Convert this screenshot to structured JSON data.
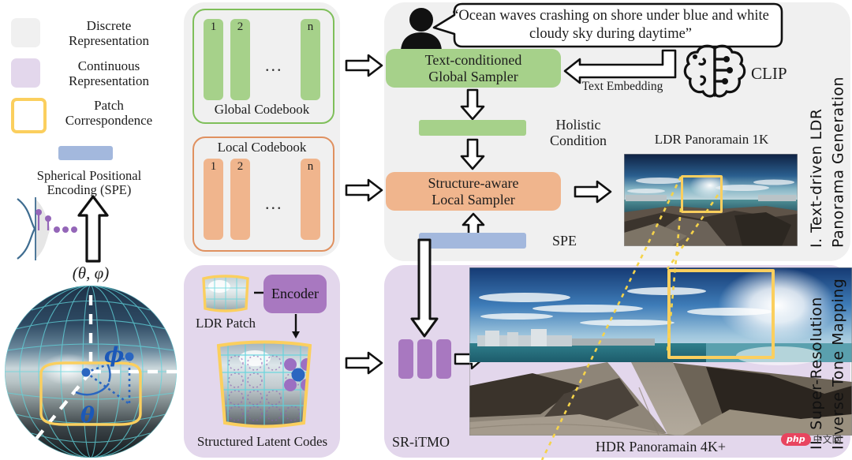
{
  "legend": {
    "items": [
      {
        "name": "discrete",
        "label": "Discrete\nRepresentation",
        "color": "#f0f0f0"
      },
      {
        "name": "continuous",
        "label": "Continuous\nRepresentation",
        "color": "#e3d7ec"
      },
      {
        "name": "patch",
        "label": "Patch\nCorrespondence",
        "color": "#fbcf5e"
      }
    ],
    "spe_label": "Spherical Positional\nEncoding (SPE)",
    "spe_color": "#a3b8dd"
  },
  "sphere": {
    "coords_label": "(θ, φ)",
    "phi": "ϕ",
    "theta": "θ"
  },
  "codebooks": {
    "global": {
      "title": "Global Codebook",
      "bar_labels": [
        "1",
        "2",
        "n"
      ],
      "ellipsis": "...",
      "color": "#a6d18a",
      "border": "#7fbf5a"
    },
    "local": {
      "title": "Local Codebook",
      "bar_labels": [
        "1",
        "2",
        "n"
      ],
      "ellipsis": "...",
      "color": "#f0b58d",
      "border": "#e09160"
    }
  },
  "stage1": {
    "prompt": "“Ocean waves crashing on shore under blue and white cloudy sky during daytime”",
    "global_sampler": "Text-conditioned\nGlobal Sampler",
    "text_embedding": "Text Embedding",
    "clip": "CLIP",
    "holistic_condition": "Holistic\nCondition",
    "local_sampler": "Structure-aware\nLocal Sampler",
    "spe": "SPE",
    "pano_label": "LDR Panoramain 1K",
    "section_title": "I. Text-driven LDR\nPanorama Generation"
  },
  "stage2": {
    "ldr_patch": "LDR Patch",
    "encoder": "Encoder",
    "latent_codes": "Structured Latent Codes",
    "sritmo": "SR-iTMO",
    "pano_label": "HDR Panoramain 4K+",
    "section_title": "II. Super-Resolution\nInverse Tone Mapping"
  },
  "watermark": {
    "brand": "php",
    "cn": "中文网"
  }
}
